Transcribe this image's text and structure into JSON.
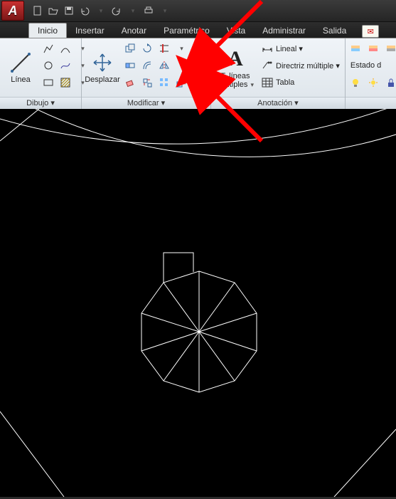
{
  "app": {
    "logo_letter": "A"
  },
  "tabs": {
    "inicio": "Inicio",
    "insertar": "Insertar",
    "anotar": "Anotar",
    "parametrico": "Paramétrico",
    "vista": "Vista",
    "administrar": "Administrar",
    "salida": "Salida"
  },
  "panels": {
    "dibujo": {
      "title": "Dibujo ▾",
      "linea": "Línea"
    },
    "modificar": {
      "title": "Modificar ▾",
      "desplazar": "Desplazar"
    },
    "anotacion": {
      "title": "Anotación ▾",
      "tlineas1": "T. líneas",
      "tlineas2": "múltiples",
      "lineal": "Lineal ▾",
      "directriz": "Directriz múltiple ▾",
      "tabla": "Tabla"
    },
    "capas": {
      "title": "",
      "estado": "Estado d"
    }
  },
  "chart_data": {
    "type": "diagram",
    "description": "CAD drawing viewport",
    "elements": [
      {
        "type": "arc-large-outer",
        "center_approx": [
          280,
          -750
        ],
        "visible_chord": true
      },
      {
        "type": "arc-large-inner",
        "concentric_with": "arc-large-outer"
      },
      {
        "type": "polygon-decagon",
        "sides": 10,
        "center": [
          280,
          465
        ],
        "radius_approx": 85,
        "subdivided_to_center": true
      },
      {
        "type": "rectangle-notch",
        "attached_to": "polygon-decagon",
        "position": "upper-left"
      },
      {
        "type": "line-lower-left"
      },
      {
        "type": "line-lower-right"
      },
      {
        "type": "line-upper-left-short"
      }
    ]
  },
  "annotations": {
    "arrows": [
      {
        "from_approx": [
          368,
          0
        ],
        "to_approx": [
          288,
          80
        ],
        "color": "#ff0000"
      },
      {
        "from_approx": [
          368,
          198
        ],
        "to_approx": [
          288,
          128
        ],
        "color": "#ff0000"
      }
    ]
  }
}
